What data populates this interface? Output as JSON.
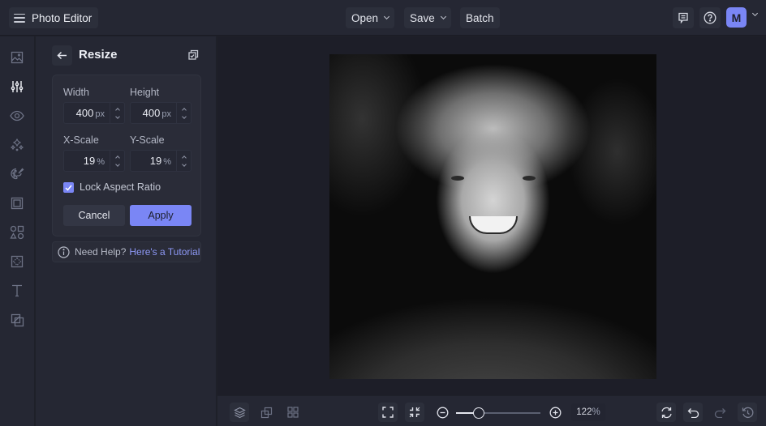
{
  "app": {
    "title": "Photo Editor"
  },
  "header": {
    "menus": [
      {
        "label": "Open",
        "has_dropdown": true
      },
      {
        "label": "Save",
        "has_dropdown": true
      },
      {
        "label": "Batch",
        "has_dropdown": false
      }
    ],
    "icons": [
      "feedback-icon",
      "help-icon"
    ],
    "user": {
      "initial": "M"
    }
  },
  "rail": {
    "items": [
      {
        "name": "image",
        "icon": "image-icon",
        "active": false
      },
      {
        "name": "adjustments",
        "icon": "sliders-icon",
        "active": true
      },
      {
        "name": "view",
        "icon": "eye-icon",
        "active": false
      },
      {
        "name": "effects",
        "icon": "sparkle-icon",
        "active": false
      },
      {
        "name": "artsy",
        "icon": "palette-icon",
        "active": false
      },
      {
        "name": "frames",
        "icon": "frame-icon",
        "active": false
      },
      {
        "name": "graphics",
        "icon": "shapes-icon",
        "active": false
      },
      {
        "name": "textures",
        "icon": "texture-icon",
        "active": false
      },
      {
        "name": "text",
        "icon": "text-icon",
        "active": false
      },
      {
        "name": "overlays",
        "icon": "overlay-icon",
        "active": false
      }
    ]
  },
  "panel": {
    "title": "Resize",
    "width": {
      "label": "Width",
      "value": "400",
      "unit": "px"
    },
    "height": {
      "label": "Height",
      "value": "400",
      "unit": "px"
    },
    "x_scale": {
      "label": "X-Scale",
      "value": "19",
      "unit": "%"
    },
    "y_scale": {
      "label": "Y-Scale",
      "value": "19",
      "unit": "%"
    },
    "lock_aspect": {
      "label": "Lock Aspect Ratio",
      "checked": true
    },
    "cancel_label": "Cancel",
    "apply_label": "Apply",
    "help": {
      "question": "Need Help?",
      "link": "Here's a Tutorial"
    }
  },
  "canvas": {
    "image_description": "Black and white portrait of a smiling young man with curly hair"
  },
  "bottombar": {
    "zoom": {
      "value": "122",
      "unit": "%",
      "slider_fraction": 0.27
    }
  },
  "colors": {
    "accent": "#7a86f5",
    "background": "#252733",
    "canvas": "#1d1e28",
    "link": "#8e99f7"
  }
}
